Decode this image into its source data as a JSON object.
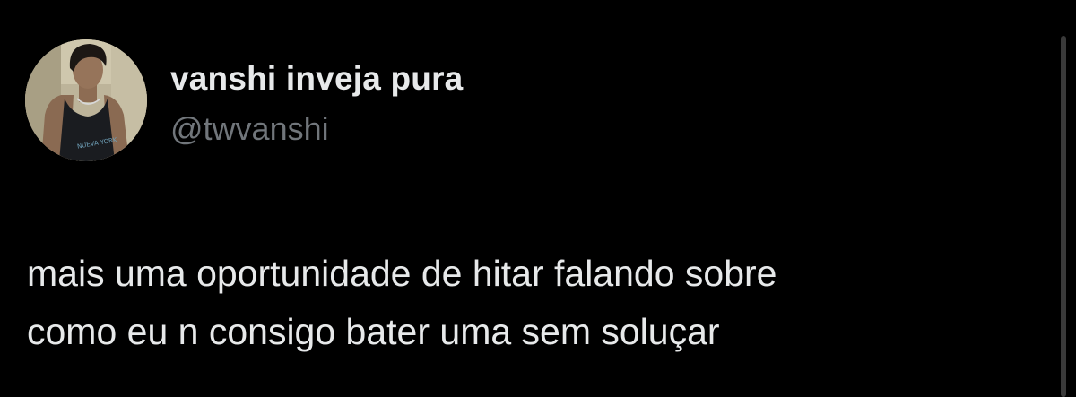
{
  "tweet": {
    "author": {
      "display_name": "vanshi inveja pura",
      "handle": "@twvanshi",
      "avatar": {
        "icon": "profile-photo-avatar",
        "shirt_print": "NUEVA YORK"
      }
    },
    "text_lines": [
      "mais uma oportunidade de hitar falando sobre",
      "como eu n consigo bater uma sem soluçar"
    ]
  },
  "colors": {
    "background": "#000000",
    "primary_text": "#e7e9ea",
    "secondary_text": "#71767b"
  }
}
